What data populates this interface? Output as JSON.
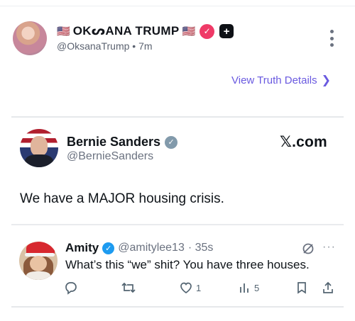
{
  "truth_post": {
    "name": "OKᔕANA TRUMP",
    "flag": "🇺🇸",
    "handle_time": "@OksanaTrump • 7m",
    "view_details_label": "View Truth Details"
  },
  "embedded_x_post": {
    "name": "Bernie Sanders",
    "handle": "@BernieSanders",
    "brand": "𝕏.com",
    "text": "We have a MAJOR housing crisis."
  },
  "reply": {
    "name": "Amity",
    "handle": "@amitylee13",
    "time": "· 35s",
    "more": "···",
    "text": "What’s this “we” shit? You have three houses.",
    "likes": "1",
    "views": "5"
  },
  "colors": {
    "truth_accent": "#6a5ae0",
    "truth_verified": "#ef3a67",
    "x_verified_gray": "#829aab",
    "x_verified_blue": "#1d9bf0"
  }
}
